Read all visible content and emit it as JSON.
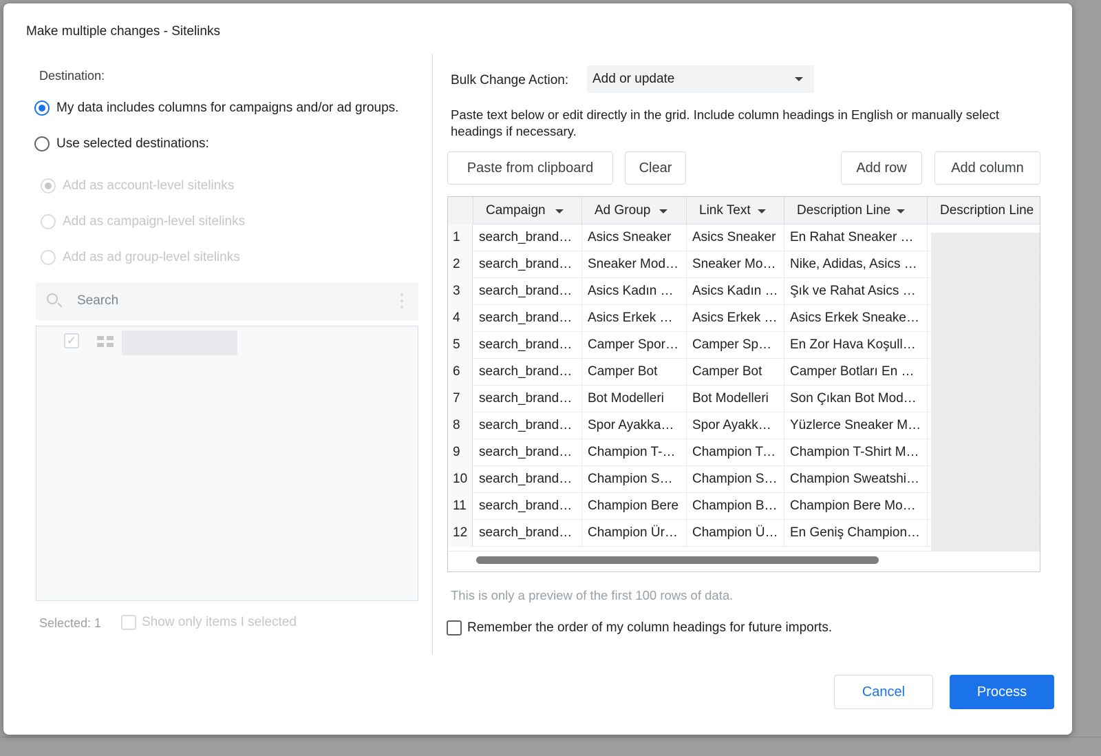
{
  "dialog": {
    "title": "Make multiple changes - Sitelinks"
  },
  "left": {
    "destination_label": "Destination:",
    "radios": [
      {
        "label": "My data includes columns for campaigns and/or ad groups.",
        "checked": true,
        "disabled": false
      },
      {
        "label": "Use selected destinations:",
        "checked": false,
        "disabled": false
      },
      {
        "label": "Add as account-level sitelinks",
        "checked": true,
        "disabled": true
      },
      {
        "label": "Add as campaign-level sitelinks",
        "checked": false,
        "disabled": true
      },
      {
        "label": "Add as ad group-level sitelinks",
        "checked": false,
        "disabled": true
      }
    ],
    "search": {
      "placeholder": "Search"
    },
    "tree": {
      "checkmark": "✓"
    },
    "selected_count": "Selected: 1",
    "show_only_label": "Show only items I selected"
  },
  "right": {
    "bulk_label": "Bulk Change Action:",
    "bulk_value": "Add or update",
    "instructions": "Paste text below or edit directly in the grid. Include column headings in English or manually select headings if necessary.",
    "buttons": {
      "paste": "Paste from clipboard",
      "clear": "Clear",
      "add_row": "Add row",
      "add_column": "Add column"
    },
    "grid": {
      "headers": [
        "Campaign",
        "Ad Group",
        "Link Text",
        "Description Line",
        "Description Line"
      ],
      "rows": [
        {
          "num": "1",
          "cells": [
            "search_brand_…",
            "Asics Sneaker",
            "Asics Sneaker",
            "En Rahat Sneaker M…"
          ]
        },
        {
          "num": "2",
          "cells": [
            "search_brand_…",
            "Sneaker Mod…",
            "Sneaker Mo…",
            "Nike, Adidas, Asics …"
          ]
        },
        {
          "num": "3",
          "cells": [
            "search_brand_…",
            "Asics Kadın S…",
            "Asics Kadın …",
            "Şık ve Rahat Asics K…"
          ]
        },
        {
          "num": "4",
          "cells": [
            "search_brand_…",
            "Asics Erkek S…",
            "Asics Erkek …",
            "Asics Erkek Sneaker…"
          ]
        },
        {
          "num": "5",
          "cells": [
            "search_brand_…",
            "Camper Spor …",
            "Camper Spo…",
            "En Zor Hava Koşulla…"
          ]
        },
        {
          "num": "6",
          "cells": [
            "search_brand_…",
            "Camper Bot",
            "Camper Bot",
            "Camper Botları En U…"
          ]
        },
        {
          "num": "7",
          "cells": [
            "search_brand_…",
            "Bot Modelleri",
            "Bot Modelleri",
            "Son Çıkan Bot Mod…"
          ]
        },
        {
          "num": "8",
          "cells": [
            "search_brand_…",
            "Spor Ayakkab…",
            "Spor Ayakka…",
            "Yüzlerce Sneaker M…"
          ]
        },
        {
          "num": "9",
          "cells": [
            "search_brand_…",
            "Champion T-S…",
            "Champion T-…",
            "Champion T-Shirt M…"
          ]
        },
        {
          "num": "10",
          "cells": [
            "search_brand_…",
            "Champion Sw…",
            "Champion S…",
            "Champion Sweatshi…"
          ]
        },
        {
          "num": "11",
          "cells": [
            "search_brand_…",
            "Champion Bere",
            "Champion B…",
            "Champion Bere Mo…"
          ]
        },
        {
          "num": "12",
          "cells": [
            "search_brand_…",
            "Champion Ür…",
            "Champion Ü…",
            "En Geniş Champion …"
          ]
        }
      ]
    },
    "preview_note": "This is only a preview of the first 100 rows of data.",
    "remember_label": "Remember the order of my column headings for future imports."
  },
  "footer": {
    "cancel": "Cancel",
    "process": "Process"
  },
  "colors": {
    "accent": "#1a73e8",
    "backdrop": "#9e9e9e"
  }
}
